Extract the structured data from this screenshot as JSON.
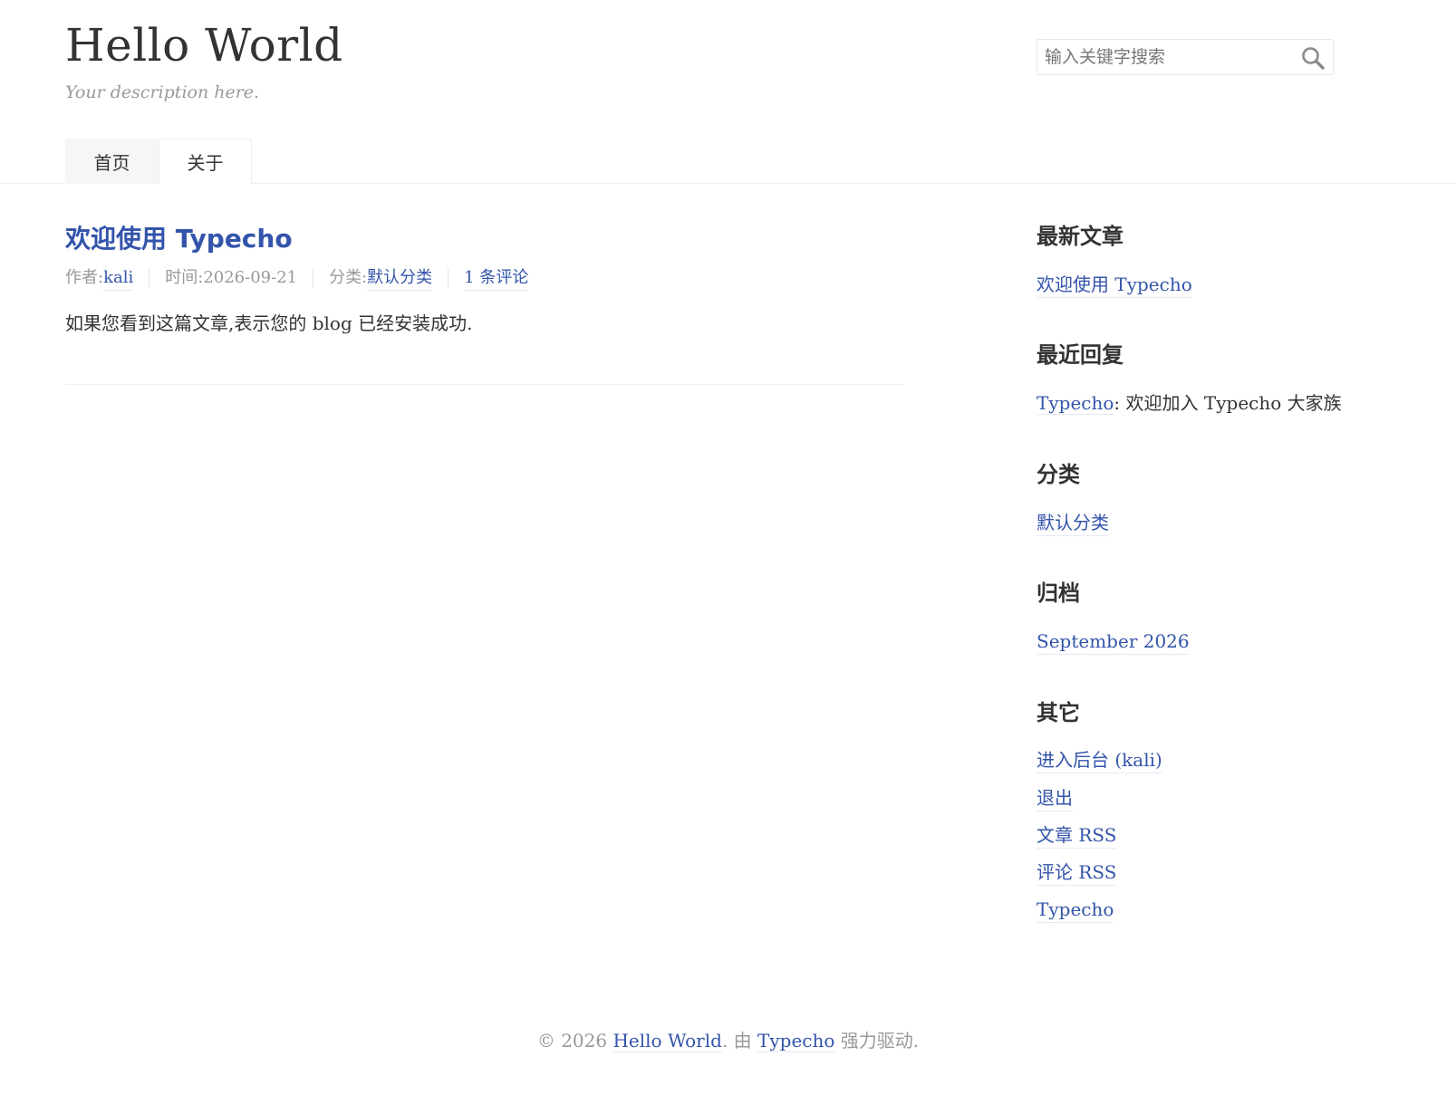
{
  "colors": {
    "link": "#3354AA",
    "text": "#333333",
    "muted": "#999999",
    "border": "#EEEEEE"
  },
  "header": {
    "site_title": "Hello World",
    "description": "Your description here.",
    "search": {
      "placeholder": "输入关键字搜索",
      "value": "",
      "icon": "search-icon"
    },
    "nav": [
      {
        "label": "首页",
        "current": true
      },
      {
        "label": "关于",
        "current": false
      }
    ]
  },
  "post": {
    "title": "欢迎使用 Typecho",
    "meta": {
      "author_label": "作者: ",
      "author": "kali",
      "time_label": "时间: ",
      "time": "2026-09-21",
      "category_label": "分类: ",
      "category": "默认分类",
      "comments": "1 条评论"
    },
    "excerpt": "如果您看到这篇文章,表示您的 blog 已经安装成功."
  },
  "sidebar": {
    "recent_posts": {
      "title": "最新文章",
      "items": [
        "欢迎使用 Typecho"
      ]
    },
    "recent_comments": {
      "title": "最近回复",
      "items": [
        {
          "author": "Typecho",
          "separator": ": ",
          "text": "欢迎加入 Typecho 大家族"
        }
      ]
    },
    "categories": {
      "title": "分类",
      "items": [
        "默认分类"
      ]
    },
    "archives": {
      "title": "归档",
      "items": [
        "September 2026"
      ]
    },
    "other": {
      "title": "其它",
      "items": [
        "进入后台 (kali)",
        "退出",
        "文章 RSS",
        "评论 RSS",
        "Typecho"
      ]
    }
  },
  "footer": {
    "copyright": "© 2026 ",
    "site_link": "Hello World",
    "middle": ". 由 ",
    "powered_link": "Typecho",
    "suffix": " 强力驱动."
  }
}
